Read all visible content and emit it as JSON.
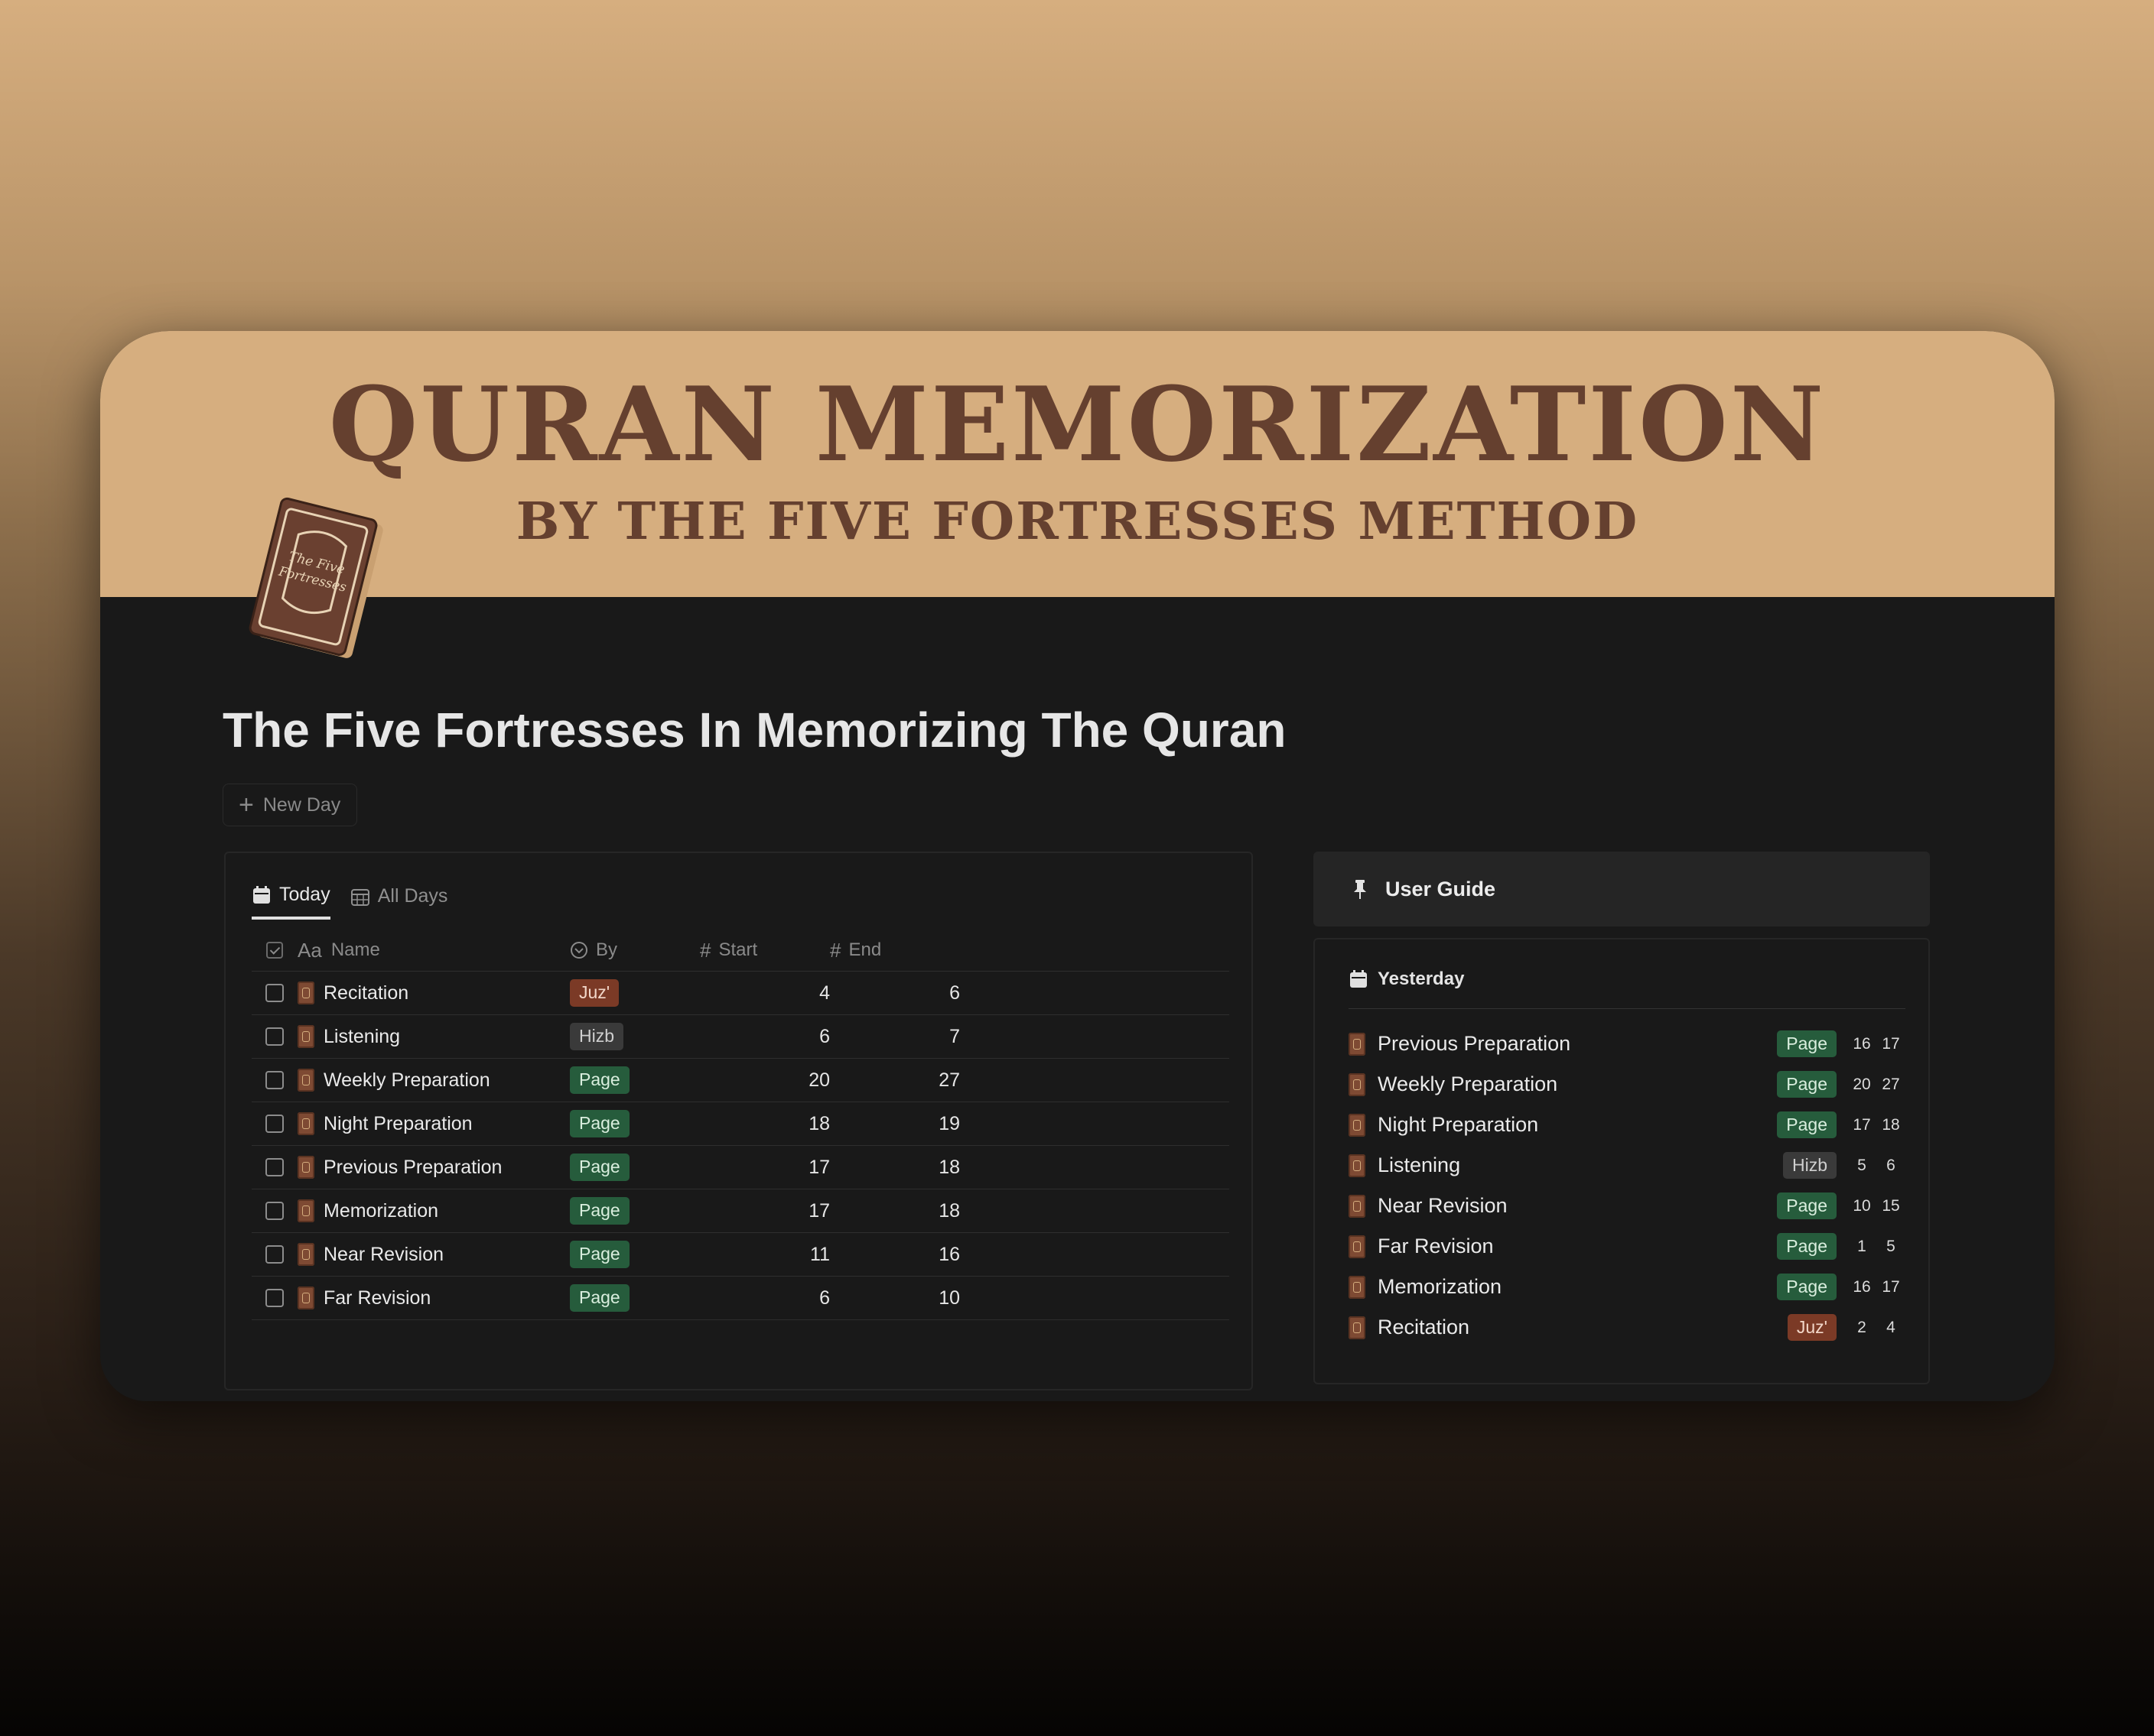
{
  "banner": {
    "title": "QURAN MEMORIZATION",
    "subtitle": "BY THE FIVE FORTRESSES METHOD",
    "book_cover_text": "The Five Fortresses"
  },
  "page": {
    "title": "The Five Fortresses In Memorizing The Quran",
    "new_day_label": "New Day"
  },
  "tabs": [
    {
      "label": "Today",
      "icon": "calendar-icon",
      "active": true
    },
    {
      "label": "All Days",
      "icon": "calendar-grid-icon",
      "active": false
    }
  ],
  "table": {
    "headers": {
      "name": "Name",
      "by": "By",
      "start": "Start",
      "end": "End",
      "name_icon": "Aa",
      "num_icon": "#"
    },
    "rows": [
      {
        "name": "Recitation",
        "by": "Juz'",
        "start": "4",
        "end": "6"
      },
      {
        "name": "Listening",
        "by": "Hizb",
        "start": "6",
        "end": "7"
      },
      {
        "name": "Weekly Preparation",
        "by": "Page",
        "start": "20",
        "end": "27"
      },
      {
        "name": "Night Preparation",
        "by": "Page",
        "start": "18",
        "end": "19"
      },
      {
        "name": "Previous Preparation",
        "by": "Page",
        "start": "17",
        "end": "18"
      },
      {
        "name": "Memorization",
        "by": "Page",
        "start": "17",
        "end": "18"
      },
      {
        "name": "Near Revision",
        "by": "Page",
        "start": "11",
        "end": "16"
      },
      {
        "name": "Far Revision",
        "by": "Page",
        "start": "6",
        "end": "10"
      }
    ]
  },
  "guide": {
    "label": "User Guide",
    "icon": "pin-icon"
  },
  "yesterday": {
    "label": "Yesterday",
    "rows": [
      {
        "name": "Previous Preparation",
        "by": "Page",
        "start": "16",
        "end": "17"
      },
      {
        "name": "Weekly Preparation",
        "by": "Page",
        "start": "20",
        "end": "27"
      },
      {
        "name": "Night Preparation",
        "by": "Page",
        "start": "17",
        "end": "18"
      },
      {
        "name": "Listening",
        "by": "Hizb",
        "start": "5",
        "end": "6"
      },
      {
        "name": "Near Revision",
        "by": "Page",
        "start": "10",
        "end": "15"
      },
      {
        "name": "Far Revision",
        "by": "Page",
        "start": "1",
        "end": "5"
      },
      {
        "name": "Memorization",
        "by": "Page",
        "start": "16",
        "end": "17"
      },
      {
        "name": "Recitation",
        "by": "Juz'",
        "start": "2",
        "end": "4"
      }
    ]
  },
  "colors": {
    "banner": "#d6ae7f",
    "banner_text": "#65402f",
    "card_bg": "#191919",
    "tag_page": "#265c3c",
    "tag_hizb": "#3a3a3a",
    "tag_juz": "#7b3a26"
  }
}
